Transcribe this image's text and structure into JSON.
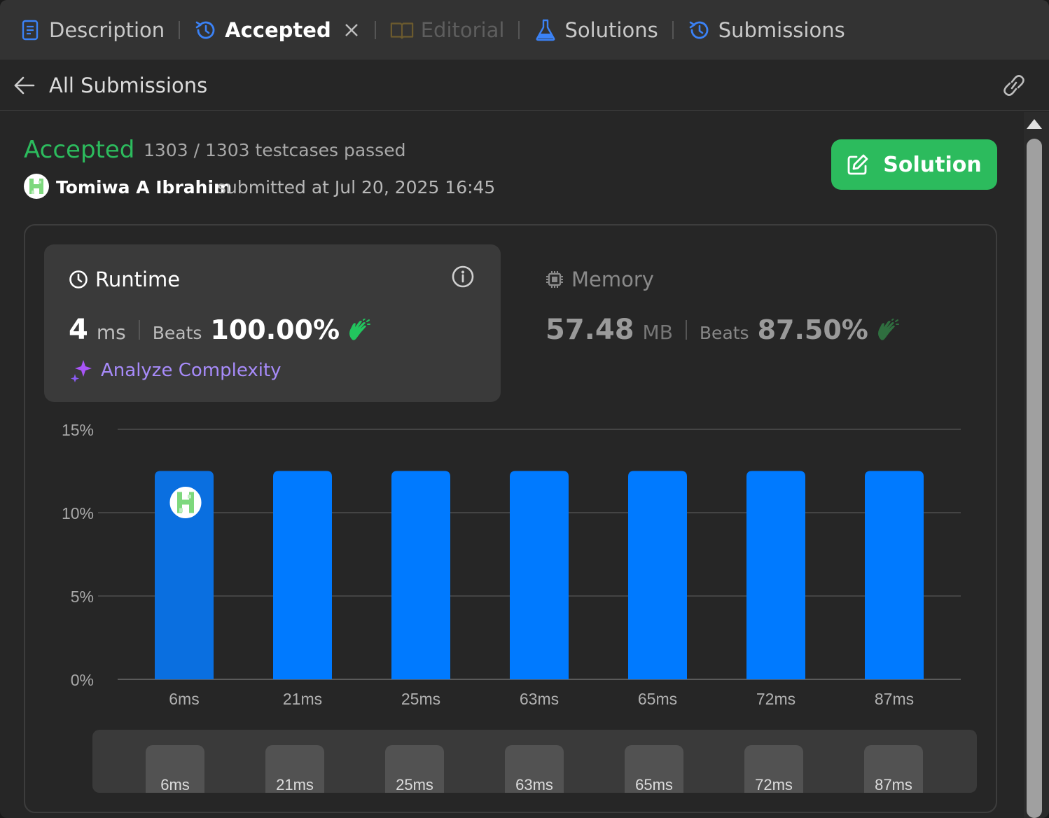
{
  "tabs": [
    {
      "label": "Description",
      "icon": "description-icon",
      "state": "normal"
    },
    {
      "label": "Accepted",
      "icon": "history-icon",
      "state": "active"
    },
    {
      "label": "Editorial",
      "icon": "book-icon",
      "state": "disabled"
    },
    {
      "label": "Solutions",
      "icon": "flask-icon",
      "state": "normal"
    },
    {
      "label": "Submissions",
      "icon": "history-icon",
      "state": "normal"
    }
  ],
  "subheader": {
    "title": "All Submissions"
  },
  "status": {
    "title": "Accepted",
    "tests": "1303 / 1303 testcases passed",
    "author": "Tomiwa A Ibrahim",
    "submitted": "submitted at Jul 20, 2025 16:45"
  },
  "solution_button": {
    "label": "Solution"
  },
  "runtime": {
    "title": "Runtime",
    "value": "4",
    "unit": "ms",
    "beats_label": "Beats",
    "beats": "100.00%",
    "analyze": "Analyze Complexity"
  },
  "memory": {
    "title": "Memory",
    "value": "57.48",
    "unit": "MB",
    "beats_label": "Beats",
    "beats": "87.50%"
  },
  "colors": {
    "accent": "#2cbb5d",
    "bar": "#007aff",
    "bar_selected": "#0a6fe0",
    "purple": "#a78bfa"
  },
  "chart_data": {
    "type": "bar",
    "categories": [
      "6ms",
      "21ms",
      "25ms",
      "63ms",
      "65ms",
      "72ms",
      "87ms"
    ],
    "values": [
      12.5,
      12.5,
      12.5,
      12.5,
      12.5,
      12.5,
      12.5
    ],
    "yticks": [
      "0%",
      "5%",
      "10%",
      "15%"
    ],
    "ylim": [
      0,
      15
    ],
    "selected_index": 0,
    "grid": true
  },
  "range_labels": [
    "6ms",
    "21ms",
    "25ms",
    "63ms",
    "65ms",
    "72ms",
    "87ms"
  ]
}
